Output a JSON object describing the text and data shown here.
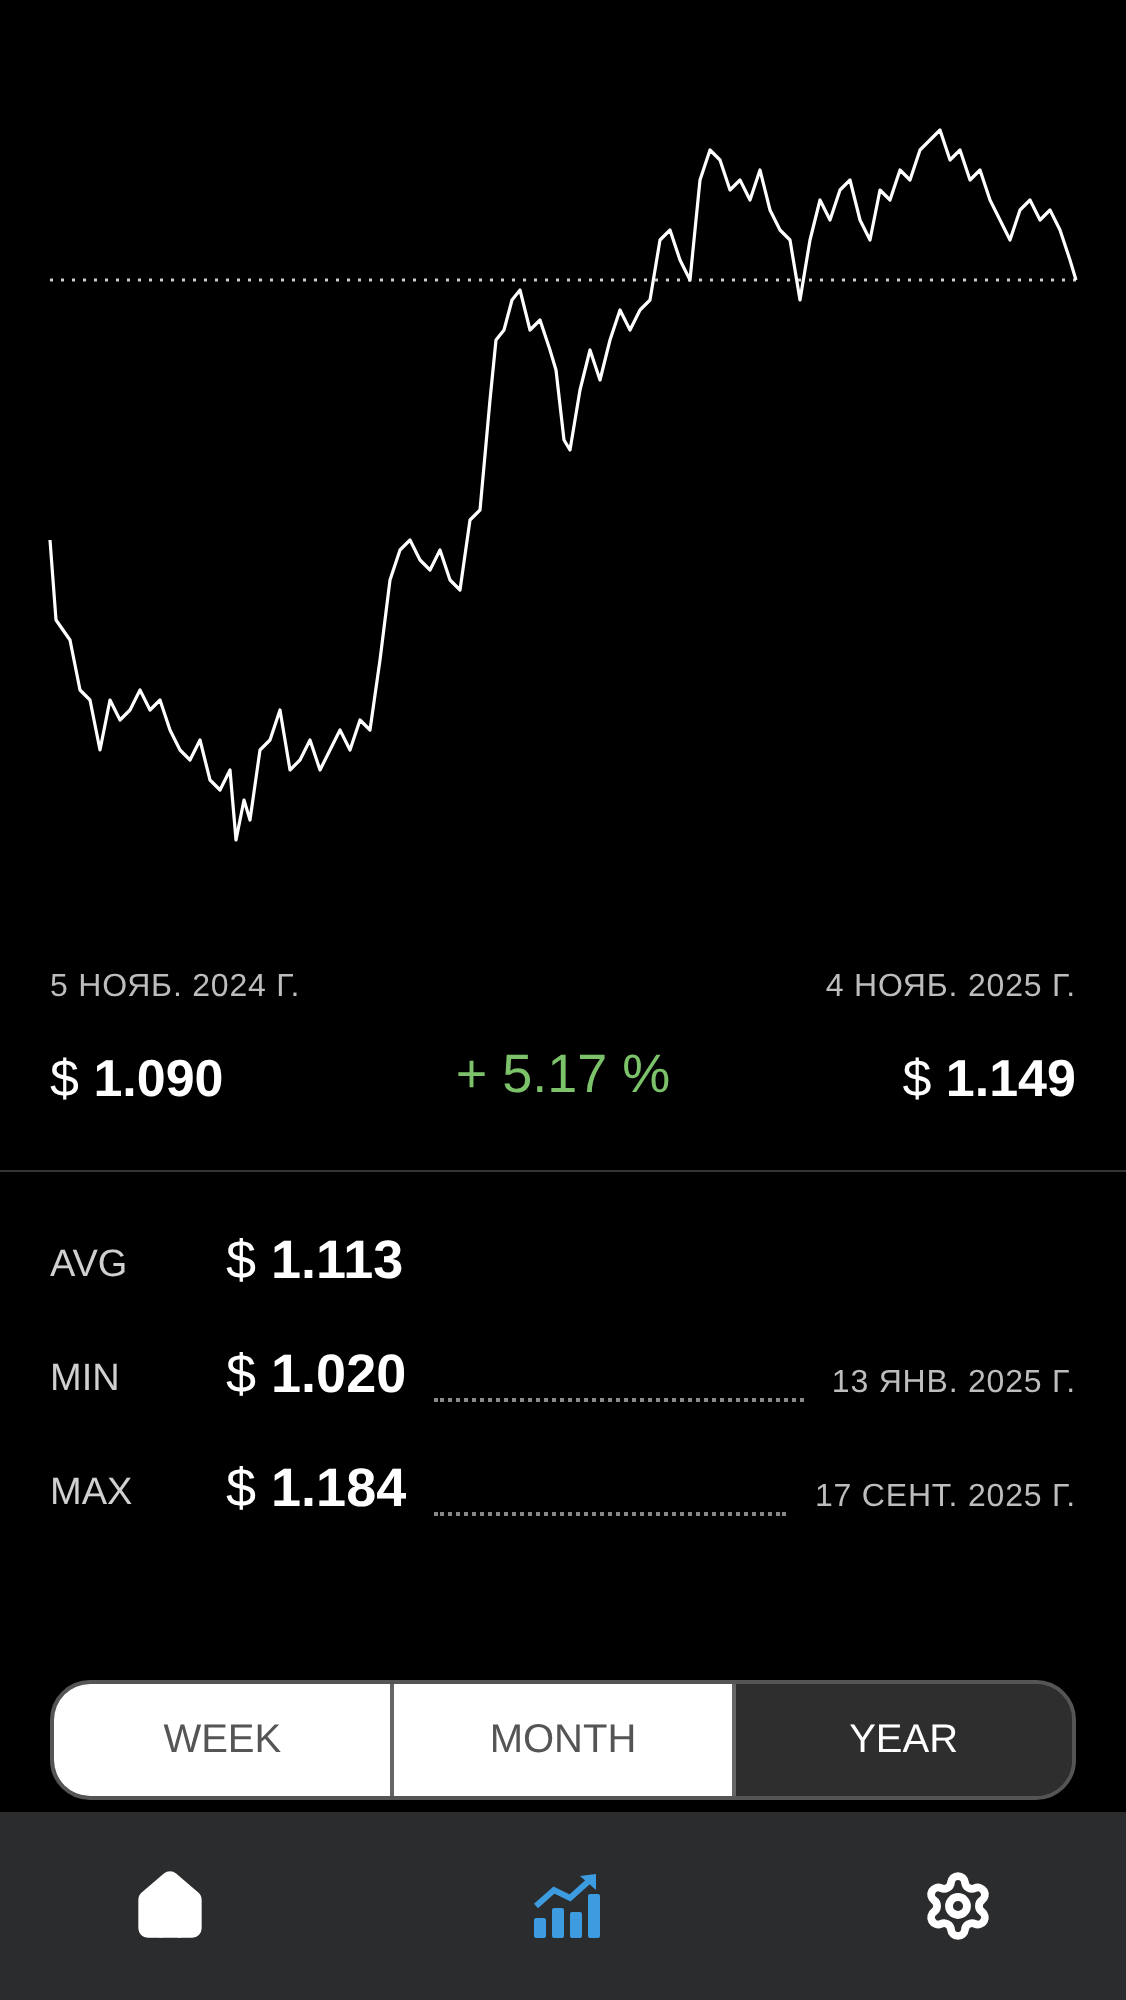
{
  "summary": {
    "start_date": "5 НОЯБ. 2024 Г.",
    "end_date": "4 НОЯБ. 2025 Г.",
    "start_value": "$ **1.090**",
    "change": "+ 5.17 %",
    "end_value": "$ **1.149**"
  },
  "stats": [
    {
      "label": "AVG",
      "value": "$ **1.113**"
    },
    {
      "label": "MIN",
      "value": "$ **1.020**",
      "date": "13 ЯНВ. 2025 Г."
    },
    {
      "label": "MAX",
      "value": "$ **1.184**",
      "date": "17 СЕНТ. 2025 Г."
    }
  ],
  "periods": [
    {
      "label": "WEEK",
      "selected": false
    },
    {
      "label": "MONTH",
      "selected": false
    },
    {
      "label": "YEAR",
      "selected": true
    }
  ],
  "nav": [
    {
      "kind": "home",
      "selected": false
    },
    {
      "kind": "stats",
      "selected": true
    },
    {
      "kind": "settings",
      "selected": false
    }
  ]
}
